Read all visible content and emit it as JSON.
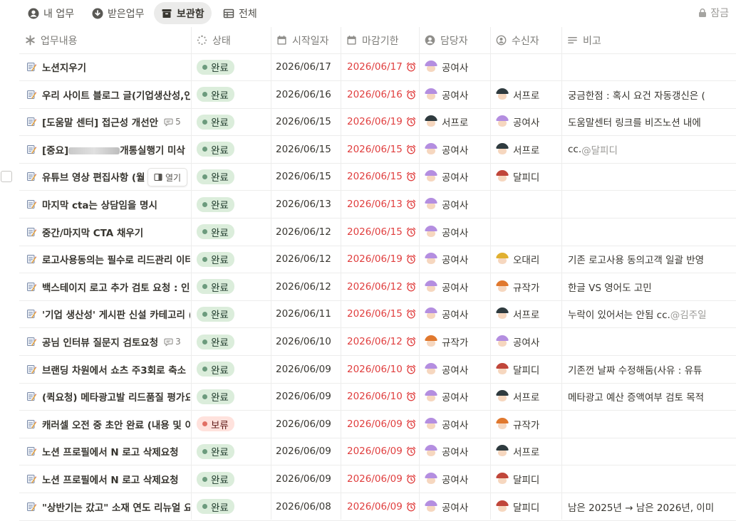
{
  "views": {
    "tabs": [
      {
        "label": "내 업무",
        "icon": "user-icon"
      },
      {
        "label": "받은업무",
        "icon": "download-icon"
      },
      {
        "label": "보관함",
        "icon": "archive-icon",
        "active": true
      },
      {
        "label": "전체",
        "icon": "table-icon"
      }
    ],
    "lock_label": "잠금"
  },
  "table": {
    "columns": [
      {
        "label": "업무내용",
        "icon": "asterisk-icon"
      },
      {
        "label": "상태",
        "icon": "status-icon"
      },
      {
        "label": "시작일자",
        "icon": "calendar-icon"
      },
      {
        "label": "마감기한",
        "icon": "calendar-icon"
      },
      {
        "label": "담당자",
        "icon": "person-icon"
      },
      {
        "label": "수신자",
        "icon": "person-circle-icon"
      },
      {
        "label": "비고",
        "icon": "text-lines-icon"
      }
    ],
    "open_button_label": "열기",
    "rows": [
      {
        "title": "노션지우기",
        "comments": "",
        "status": "완료",
        "start": "2026/06/17",
        "due": "2026/06/17",
        "owner": "공여사",
        "receiver": "",
        "note": ""
      },
      {
        "title": "우리 사이트 블로그 글(기업생산성,인",
        "comments": "",
        "status": "완료",
        "start": "2026/06/16",
        "due": "2026/06/16",
        "owner": "공여사",
        "receiver": "서프로",
        "note": "궁금한점 : 혹시 요건 자동갱신은 (",
        "mention": ""
      },
      {
        "title": "[도움말 센터] 접근성 개선안",
        "comments": "5",
        "status": "완료",
        "start": "2026/06/15",
        "due": "2026/06/19",
        "owner": "서프로",
        "receiver": "공여사",
        "note": "도움말센터 링크를 비즈노션 내에"
      },
      {
        "title_prefix": "[중요]",
        "title": "개통실행기 미삭",
        "redacted": true,
        "comments": "",
        "status": "완료",
        "start": "2026/06/15",
        "due": "2026/06/15",
        "owner": "공여사",
        "receiver": "서프로",
        "note": "cc. ",
        "mention": "@달피디"
      },
      {
        "title": "유튜브 영상 편집사항 (월",
        "comments": "",
        "status": "완료",
        "start": "2026/06/15",
        "due": "2026/06/15",
        "owner": "공여사",
        "receiver": "달피디",
        "note": "",
        "hovered": true
      },
      {
        "title": "마지막 cta는 상담임을 명시",
        "comments": "",
        "status": "완료",
        "start": "2026/06/13",
        "due": "2026/06/13",
        "owner": "공여사",
        "receiver": "",
        "note": ""
      },
      {
        "title": "중간/마지막 CTA 채우기",
        "comments": "",
        "status": "완료",
        "start": "2026/06/12",
        "due": "2026/06/15",
        "owner": "공여사",
        "receiver": "",
        "note": ""
      },
      {
        "title": "로고사용동의는 필수로 리드관리 이터",
        "comments": "",
        "status": "완료",
        "start": "2026/06/12",
        "due": "2026/06/19",
        "owner": "공여사",
        "receiver": "오대리",
        "note": "기존 로고사용 동의고객 일괄 반영"
      },
      {
        "title": "백스테이지 로고 추가 검토 요청 : 인",
        "comments": "",
        "status": "완료",
        "start": "2026/06/12",
        "due": "2026/06/12",
        "owner": "공여사",
        "receiver": "규작가",
        "note": "한글 VS 영어도 고민"
      },
      {
        "title": "'기업 생산성' 게시판 신설 카테고리 (",
        "comments": "",
        "status": "완료",
        "start": "2026/06/11",
        "due": "2026/06/15",
        "owner": "공여사",
        "receiver": "서프로",
        "note": "누락이 있어서는 안됨 cc. ",
        "mention": "@김주일"
      },
      {
        "title": "공님 인터뷰 질문지 검토요청",
        "comments": "3",
        "status": "완료",
        "start": "2026/06/10",
        "due": "2026/06/12",
        "owner": "규작가",
        "receiver": "공여사",
        "note": ""
      },
      {
        "title": "브랜딩 차원에서 쇼츠 주3회로 축소",
        "comments": "",
        "status": "완료",
        "start": "2026/06/09",
        "due": "2026/06/10",
        "owner": "공여사",
        "receiver": "달피디",
        "note": "기존껀 날짜 수정해둠(사유 : 유튜"
      },
      {
        "title": "(퀵요청) 메타광고발 리드품질 평가요",
        "comments": "",
        "status": "완료",
        "start": "2026/06/09",
        "due": "2026/06/10",
        "owner": "공여사",
        "receiver": "서프로",
        "note": "메타광고 예산 증액여부 검토 목적"
      },
      {
        "title": "캐러셀 오전 중 초안 완료 (내용 및 이",
        "comments": "",
        "status": "보류",
        "start": "2026/06/09",
        "due": "2026/06/09",
        "owner": "공여사",
        "receiver": "규작가",
        "note": ""
      },
      {
        "title": "노션 프로필에서 N 로고 삭제요청",
        "comments": "",
        "status": "완료",
        "start": "2026/06/09",
        "due": "2026/06/09",
        "owner": "공여사",
        "receiver": "서프로",
        "note": ""
      },
      {
        "title": "노션 프로필에서 N 로고 삭제요청",
        "comments": "",
        "status": "완료",
        "start": "2026/06/09",
        "due": "2026/06/09",
        "owner": "공여사",
        "receiver": "달피디",
        "note": ""
      },
      {
        "title": "\"상반기는 갔고\" 소재 연도 리뉴얼 요",
        "comments": "",
        "status": "완료",
        "start": "2026/06/08",
        "due": "2026/06/09",
        "owner": "공여사",
        "receiver": "달피디",
        "note": "남은 2025년 → 남은 2026년, 이미"
      }
    ]
  },
  "colors": {
    "due_red": "#e03e3e",
    "done_bg": "#dbeddb",
    "hold_bg": "#ffe2dd",
    "avatar_hair": {
      "공여사": "#b48ee0",
      "서프로": "#2f3b3f",
      "달피디": "#c0463a",
      "오대리": "#e0b030",
      "규작가": "#e0782e"
    }
  }
}
